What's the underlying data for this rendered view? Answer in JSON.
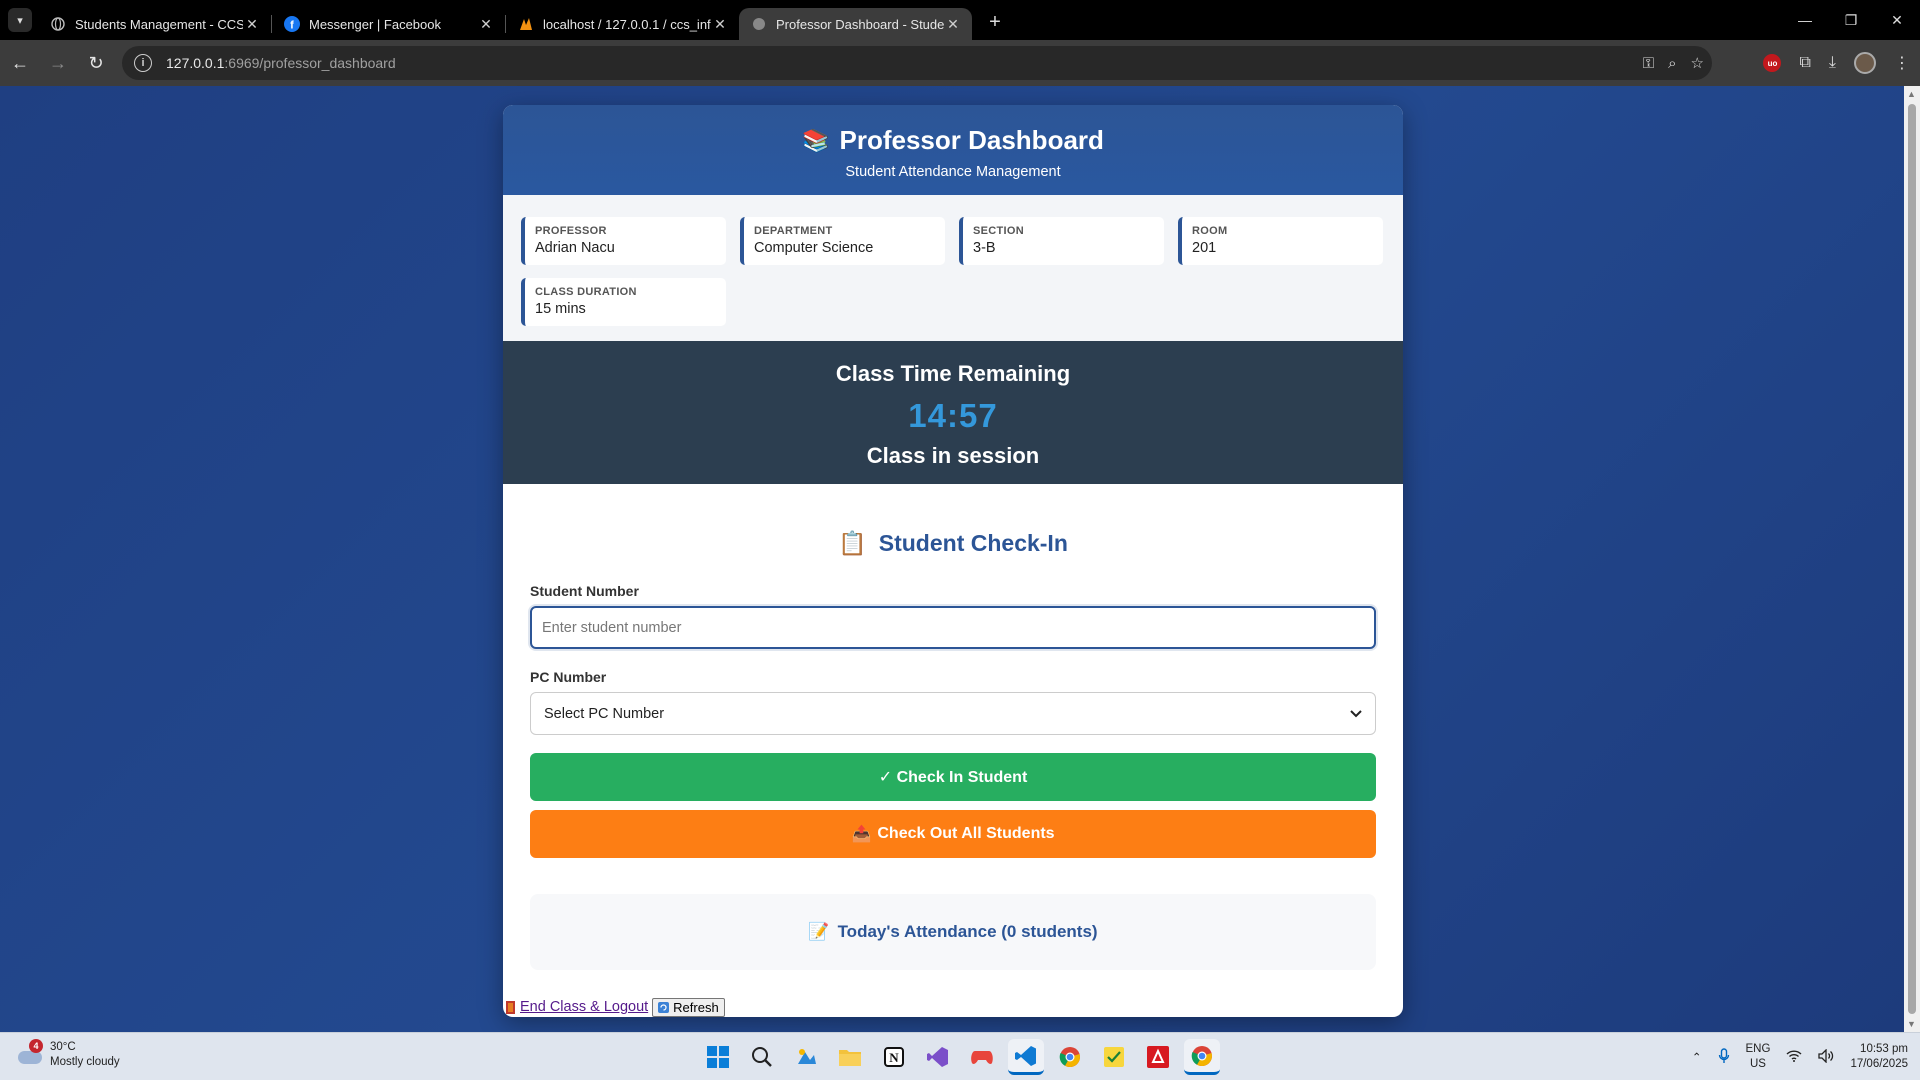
{
  "browser": {
    "tabs": [
      {
        "title": "Students Management - CCS A",
        "active": false
      },
      {
        "title": "Messenger | Facebook",
        "active": false
      },
      {
        "title": "localhost / 127.0.0.1 / ccs_info /",
        "active": false
      },
      {
        "title": "Professor Dashboard - Student",
        "active": true
      }
    ],
    "new_tab": "+",
    "url_host": "127.0.0.1",
    "url_path": ":6969/professor_dashboard"
  },
  "header": {
    "icon": "📚",
    "title": "Professor Dashboard",
    "subtitle": "Student Attendance Management"
  },
  "info": [
    {
      "label": "PROFESSOR",
      "value": "Adrian Nacu"
    },
    {
      "label": "DEPARTMENT",
      "value": "Computer Science"
    },
    {
      "label": "SECTION",
      "value": "3-B"
    },
    {
      "label": "ROOM",
      "value": "201"
    },
    {
      "label": "CLASS DURATION",
      "value": "15 mins"
    }
  ],
  "timer": {
    "heading": "Class Time Remaining",
    "time": "14:57",
    "status": "Class in session"
  },
  "checkin": {
    "icon": "📋",
    "heading": "Student Check-In",
    "student_label": "Student Number",
    "student_placeholder": "Enter student number",
    "pc_label": "PC Number",
    "pc_selected": "Select PC Number",
    "checkin_button": "✓ Check In Student",
    "checkout_icon": "📤",
    "checkout_button": "Check Out All Students",
    "attendance_icon": "📝",
    "attendance_title": "Today's Attendance (0 students)"
  },
  "footer": {
    "logout": "End Class & Logout",
    "refresh": "Refresh"
  },
  "taskbar": {
    "weather_badge": "4",
    "temperature": "30°C",
    "condition": "Mostly cloudy",
    "lang_top": "ENG",
    "lang_bottom": "US",
    "time": "10:53 pm",
    "date": "17/06/2025"
  },
  "colors": {
    "page_bg": "#1f3f82",
    "header_blue": "#2c5596",
    "timer_bg": "#2c3e50",
    "timer_clock": "#3498db",
    "green": "#27ae60",
    "orange": "#fd7e14"
  }
}
